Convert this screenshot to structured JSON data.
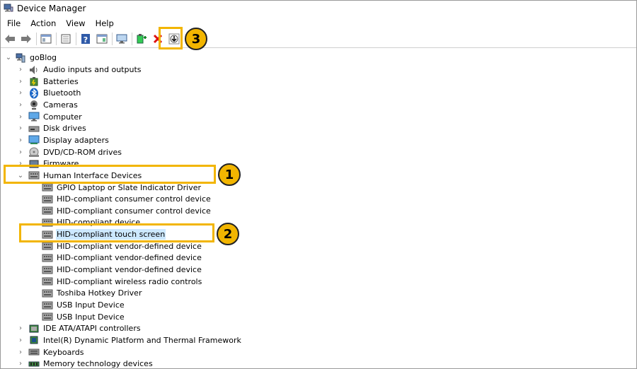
{
  "window": {
    "title": "Device Manager"
  },
  "menu": [
    "File",
    "Action",
    "View",
    "Help"
  ],
  "toolbar": {
    "buttons": [
      "back-icon",
      "forward-icon",
      "properties-icon",
      "show-hide-icon",
      "help-icon",
      "details-icon",
      "monitor-icon",
      "add-driver-icon",
      "uninstall-icon",
      "update-driver-icon"
    ]
  },
  "tree": {
    "root": "goBlog",
    "items": [
      {
        "label": "Audio inputs and outputs",
        "icon": "speaker-icon"
      },
      {
        "label": "Batteries",
        "icon": "battery-icon"
      },
      {
        "label": "Bluetooth",
        "icon": "bluetooth-icon"
      },
      {
        "label": "Cameras",
        "icon": "camera-icon"
      },
      {
        "label": "Computer",
        "icon": "computer-icon"
      },
      {
        "label": "Disk drives",
        "icon": "disk-icon"
      },
      {
        "label": "Display adapters",
        "icon": "display-adapter-icon"
      },
      {
        "label": "DVD/CD-ROM drives",
        "icon": "dvd-icon"
      },
      {
        "label": "Firmware",
        "icon": "firmware-icon"
      },
      {
        "label": "Human Interface Devices",
        "icon": "hid-icon",
        "expanded": true
      },
      {
        "label": "GPIO Laptop or Slate Indicator Driver",
        "icon": "hid-icon",
        "child": true
      },
      {
        "label": "HID-compliant consumer control device",
        "icon": "hid-icon",
        "child": true
      },
      {
        "label": "HID-compliant consumer control device",
        "icon": "hid-icon",
        "child": true
      },
      {
        "label": "HID-compliant device",
        "icon": "hid-icon",
        "child": true
      },
      {
        "label": "HID-compliant touch screen",
        "icon": "hid-icon",
        "child": true,
        "selected": true
      },
      {
        "label": "HID-compliant vendor-defined device",
        "icon": "hid-icon",
        "child": true
      },
      {
        "label": "HID-compliant vendor-defined device",
        "icon": "hid-icon",
        "child": true
      },
      {
        "label": "HID-compliant vendor-defined device",
        "icon": "hid-icon",
        "child": true
      },
      {
        "label": "HID-compliant wireless radio controls",
        "icon": "hid-icon",
        "child": true
      },
      {
        "label": "Toshiba Hotkey Driver",
        "icon": "hid-icon",
        "child": true
      },
      {
        "label": "USB Input Device",
        "icon": "hid-icon",
        "child": true
      },
      {
        "label": "USB Input Device",
        "icon": "hid-icon",
        "child": true
      },
      {
        "label": "IDE ATA/ATAPI controllers",
        "icon": "ide-icon"
      },
      {
        "label": "Intel(R) Dynamic Platform and Thermal Framework",
        "icon": "chip-icon"
      },
      {
        "label": "Keyboards",
        "icon": "keyboard-icon"
      },
      {
        "label": "Memory technology devices",
        "icon": "memory-icon"
      }
    ]
  },
  "annotations": [
    "1",
    "2",
    "3"
  ]
}
